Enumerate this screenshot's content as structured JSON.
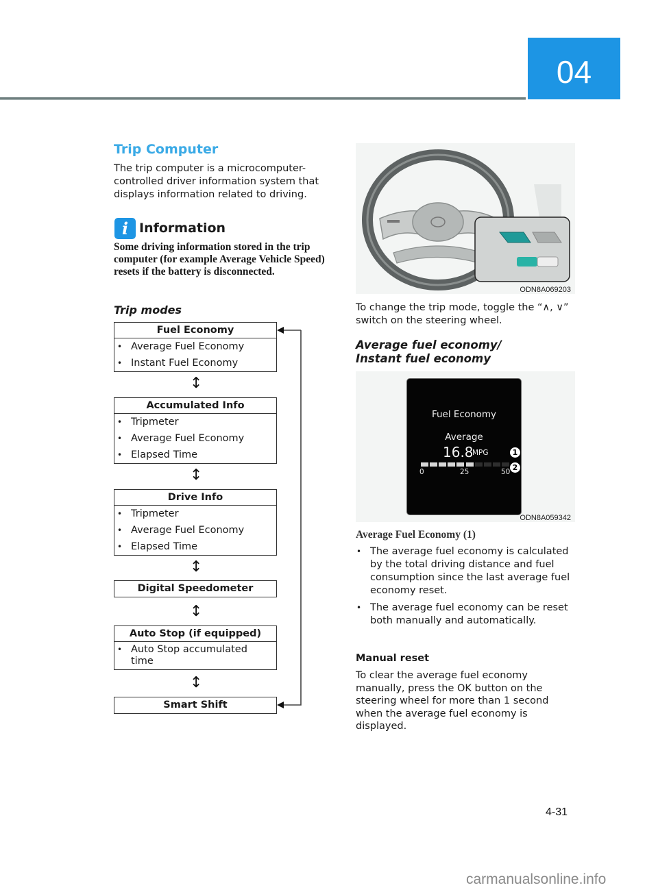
{
  "header": {
    "chapter": "04"
  },
  "left": {
    "section_title": "Trip Computer",
    "intro": "The trip computer is a microcomputer-controlled driver information system that displays information related to driving.",
    "info": {
      "icon_glyph": "i",
      "title": "Information",
      "body": "Some driving information stored in the trip computer (for example Average Vehicle Speed) resets if the battery is disconnected."
    },
    "trip_modes_title": "Trip modes",
    "updown_glyph": "↕",
    "bullet_glyph": "•",
    "modes": [
      {
        "title": "Fuel Economy",
        "items": [
          "Average Fuel Economy",
          "Instant Fuel Economy"
        ]
      },
      {
        "title": "Accumulated Info",
        "items": [
          "Tripmeter",
          "Average Fuel Economy",
          "Elapsed Time"
        ]
      },
      {
        "title": "Drive Info",
        "items": [
          "Tripmeter",
          "Average Fuel Economy",
          "Elapsed Time"
        ]
      },
      {
        "title": "Digital Speedometer",
        "items": []
      },
      {
        "title": "Auto Stop (if equipped)",
        "items": [
          "Auto Stop accumulated time"
        ]
      },
      {
        "title": "Smart Shift",
        "items": []
      }
    ]
  },
  "right": {
    "wheel_figure_code": "ODN8A069203",
    "toggle_text": "To change the trip mode, toggle the “∧, ∨” switch on the steering wheel.",
    "sub_heading_line1": "Average fuel economy/",
    "sub_heading_line2": "Instant fuel economy",
    "cluster": {
      "title": "Fuel Economy",
      "label": "Average",
      "value": "16.8",
      "unit": "MPG",
      "gauge_min": "0",
      "gauge_mid": "25",
      "gauge_max": "50",
      "gauge_fill_fraction": 0.6,
      "callout_1": "1",
      "callout_2": "2"
    },
    "cluster_figure_code": "ODN8A059342",
    "avg_heading": "Average Fuel Economy (1)",
    "bullets": [
      "The average fuel economy is calculated by the total driving distance and fuel consumption since the last average fuel economy reset.",
      "The average fuel economy can be reset both manually and automatically."
    ],
    "manual_reset_title": "Manual reset",
    "manual_reset_body": "To clear the average fuel economy manually, press the OK button on the steering wheel for more than 1 second when the average fuel economy is displayed."
  },
  "footer": {
    "page_number": "4-31",
    "watermark": "carmanualsonline.info"
  },
  "colors": {
    "accent_blue": "#1d95e4",
    "title_blue": "#3aaae6",
    "teal_button": "#1f9a98"
  }
}
